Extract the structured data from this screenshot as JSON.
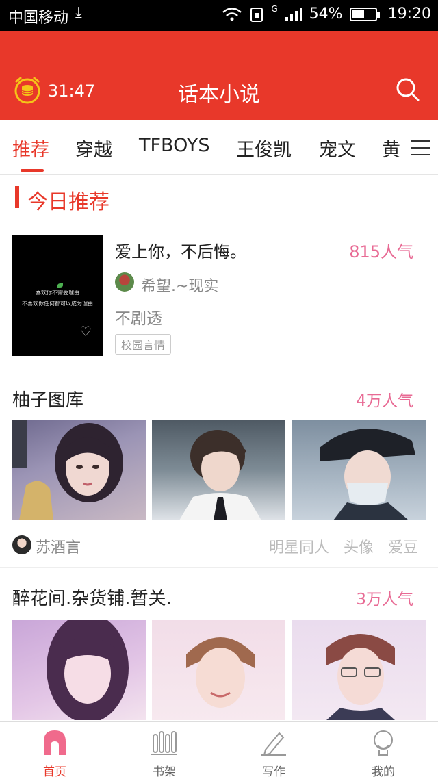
{
  "status_bar": {
    "carrier": "中国移动",
    "network": "G",
    "battery": "54%",
    "battery_level": 0.54,
    "time": "19:20"
  },
  "header": {
    "timer": "31:47",
    "title": "话本小说",
    "alarm_icon": "coin-alarm-icon",
    "search_icon": "search-icon"
  },
  "tabs": [
    "推荐",
    "穿越",
    "TFBOYS",
    "王俊凯",
    "宠文",
    "黄"
  ],
  "today_section": {
    "label": "今日推荐"
  },
  "featured_book": {
    "title": "爱上你，不后悔。",
    "popularity": "815人气",
    "author": "希望.~现实",
    "description": "不剧透",
    "tag": "校园言情",
    "cover_line1": "喜欢你不需要理由",
    "cover_line2": "不喜欢你任何都可以成为理由"
  },
  "gallery1": {
    "title": "柚子图库",
    "popularity": "4万人气",
    "owner": "苏酒言",
    "tags": [
      "明星同人",
      "头像",
      "爱豆"
    ]
  },
  "gallery2": {
    "title": "醉花间.杂货铺.暂关.",
    "popularity": "3万人气"
  },
  "bottom_nav": [
    {
      "label": "首页",
      "icon": "home-icon"
    },
    {
      "label": "书架",
      "icon": "bookshelf-icon"
    },
    {
      "label": "写作",
      "icon": "pen-icon"
    },
    {
      "label": "我的",
      "icon": "profile-icon"
    }
  ],
  "colors": {
    "brand_red": "#e8382a",
    "popularity_pink": "#e86a94"
  }
}
